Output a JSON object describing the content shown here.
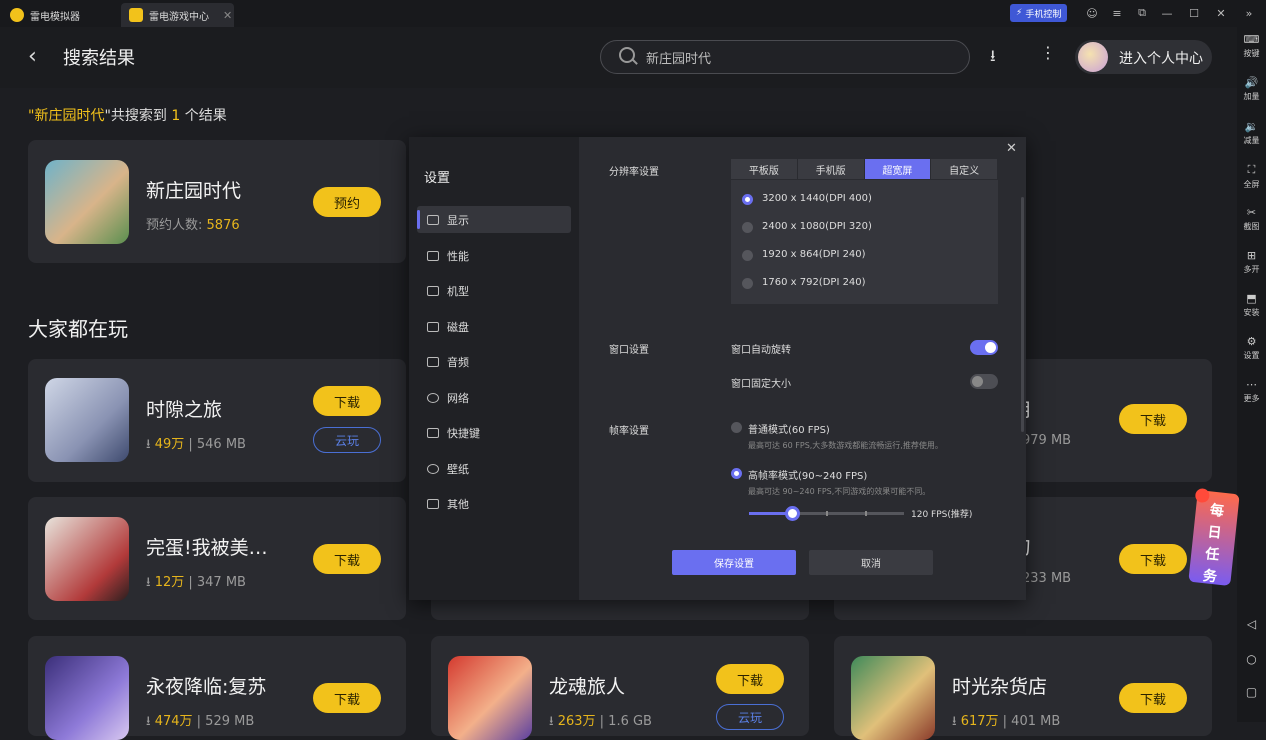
{
  "tabs": [
    {
      "label": "雷电模拟器"
    },
    {
      "label": "雷电游戏中心"
    }
  ],
  "titlebar": {
    "phone_control": "手机控制"
  },
  "header": {
    "title": "搜索结果",
    "search_value": "新庄园时代",
    "user_label": "进入个人中心"
  },
  "summary": {
    "prefix": "\"",
    "query": "新庄园时代",
    "mid": "\"共搜索到 ",
    "count": "1",
    "suffix": " 个结果"
  },
  "result": {
    "name": "新庄园时代",
    "meta_label": "预约人数:",
    "meta_value": "5876",
    "button": "预约"
  },
  "section_title": "大家都在玩",
  "games": [
    {
      "name": "时隙之旅",
      "downloads": "49万",
      "size": "546 MB",
      "button": "下载",
      "cloud": "云玩"
    },
    {
      "name": "完蛋!我被美…",
      "downloads": "12万",
      "size": "347 MB",
      "button": "下载"
    },
    {
      "name": "永夜降临:复苏",
      "downloads": "474万",
      "size": "529 MB",
      "button": "下载"
    },
    {
      "name": "龙魂旅人",
      "downloads": "263万",
      "size": "1.6 GB",
      "button": "下载",
      "cloud": "云玩"
    },
    {
      "name": "时光杂货店",
      "downloads": "617万",
      "size": "401 MB",
      "button": "下载"
    },
    {
      "name_tail": "用",
      "size": "979 MB",
      "button": "下载"
    },
    {
      "name_tail": "刀",
      "size": "233 MB",
      "button": "下载"
    }
  ],
  "rightbar": [
    {
      "label": "按键",
      "icon": "keyboard-icon"
    },
    {
      "label": "加量",
      "icon": "volume-up-icon"
    },
    {
      "label": "减量",
      "icon": "volume-down-icon"
    },
    {
      "label": "全屏",
      "icon": "fullscreen-icon"
    },
    {
      "label": "截图",
      "icon": "scissors-icon"
    },
    {
      "label": "多开",
      "icon": "multi-instance-icon"
    },
    {
      "label": "安装",
      "icon": "install-icon"
    },
    {
      "label": "设置",
      "icon": "gear-icon"
    },
    {
      "label": "更多",
      "icon": "more-icon"
    }
  ],
  "settings": {
    "title": "设置",
    "nav": [
      {
        "label": "显示",
        "icon": "monitor-icon"
      },
      {
        "label": "性能",
        "icon": "performance-icon"
      },
      {
        "label": "机型",
        "icon": "device-icon"
      },
      {
        "label": "磁盘",
        "icon": "disk-icon"
      },
      {
        "label": "音频",
        "icon": "audio-icon"
      },
      {
        "label": "网络",
        "icon": "globe-icon"
      },
      {
        "label": "快捷键",
        "icon": "shortcut-icon"
      },
      {
        "label": "壁纸",
        "icon": "palette-icon"
      },
      {
        "label": "其他",
        "icon": "grid-icon"
      }
    ],
    "resolution_label": "分辨率设置",
    "res_tabs": [
      "平板版",
      "手机版",
      "超宽屏",
      "自定义"
    ],
    "res_options": [
      "3200 x 1440(DPI 400)",
      "2400 x 1080(DPI 320)",
      "1920 x 864(DPI 240)",
      "1760 x 792(DPI 240)"
    ],
    "window_label": "窗口设置",
    "auto_rotate": "窗口自动旋转",
    "auto_rotate_on": true,
    "fixed_size": "窗口固定大小",
    "fixed_size_on": false,
    "fps_label": "帧率设置",
    "fps_normal": "普通模式(60 FPS)",
    "fps_normal_hint": "最高可达 60 FPS,大多数游戏都能流畅运行,推荐使用。",
    "fps_high": "高帧率模式(90~240 FPS)",
    "fps_high_hint": "最高可达 90~240 FPS,不同游戏的效果可能不同。",
    "fps_value": "120 FPS(推荐)",
    "fps_slider_fraction": 0.28,
    "save": "保存设置",
    "cancel": "取消",
    "accent": "#6a6ff0"
  },
  "daily_task": "每日任务"
}
